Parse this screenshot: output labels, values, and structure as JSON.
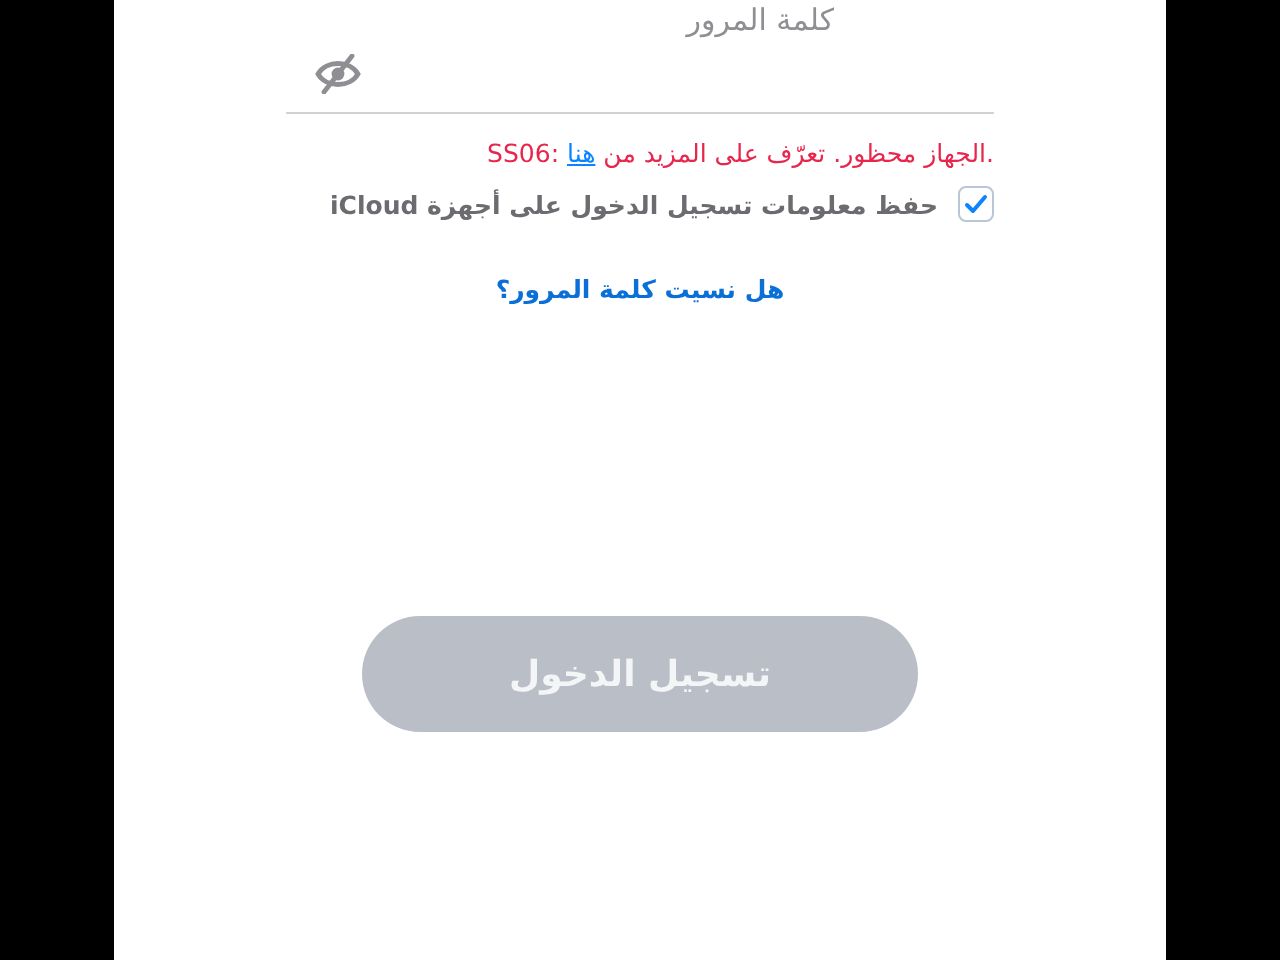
{
  "password_field": {
    "label": "كلمة المرور",
    "password_hidden": true
  },
  "error": {
    "text_before": ".الجهاز محظور. تعرّف على المزيد من ",
    "link": "هنا",
    "text_after": " :SS06"
  },
  "remember": {
    "label": "حفظ معلومات تسجيل الدخول على أجهزة iCloud",
    "checked": true
  },
  "forgot_link": "هل نسيت كلمة المرور؟",
  "login_button": {
    "label": "تسجيل الدخول",
    "disabled": true
  }
}
